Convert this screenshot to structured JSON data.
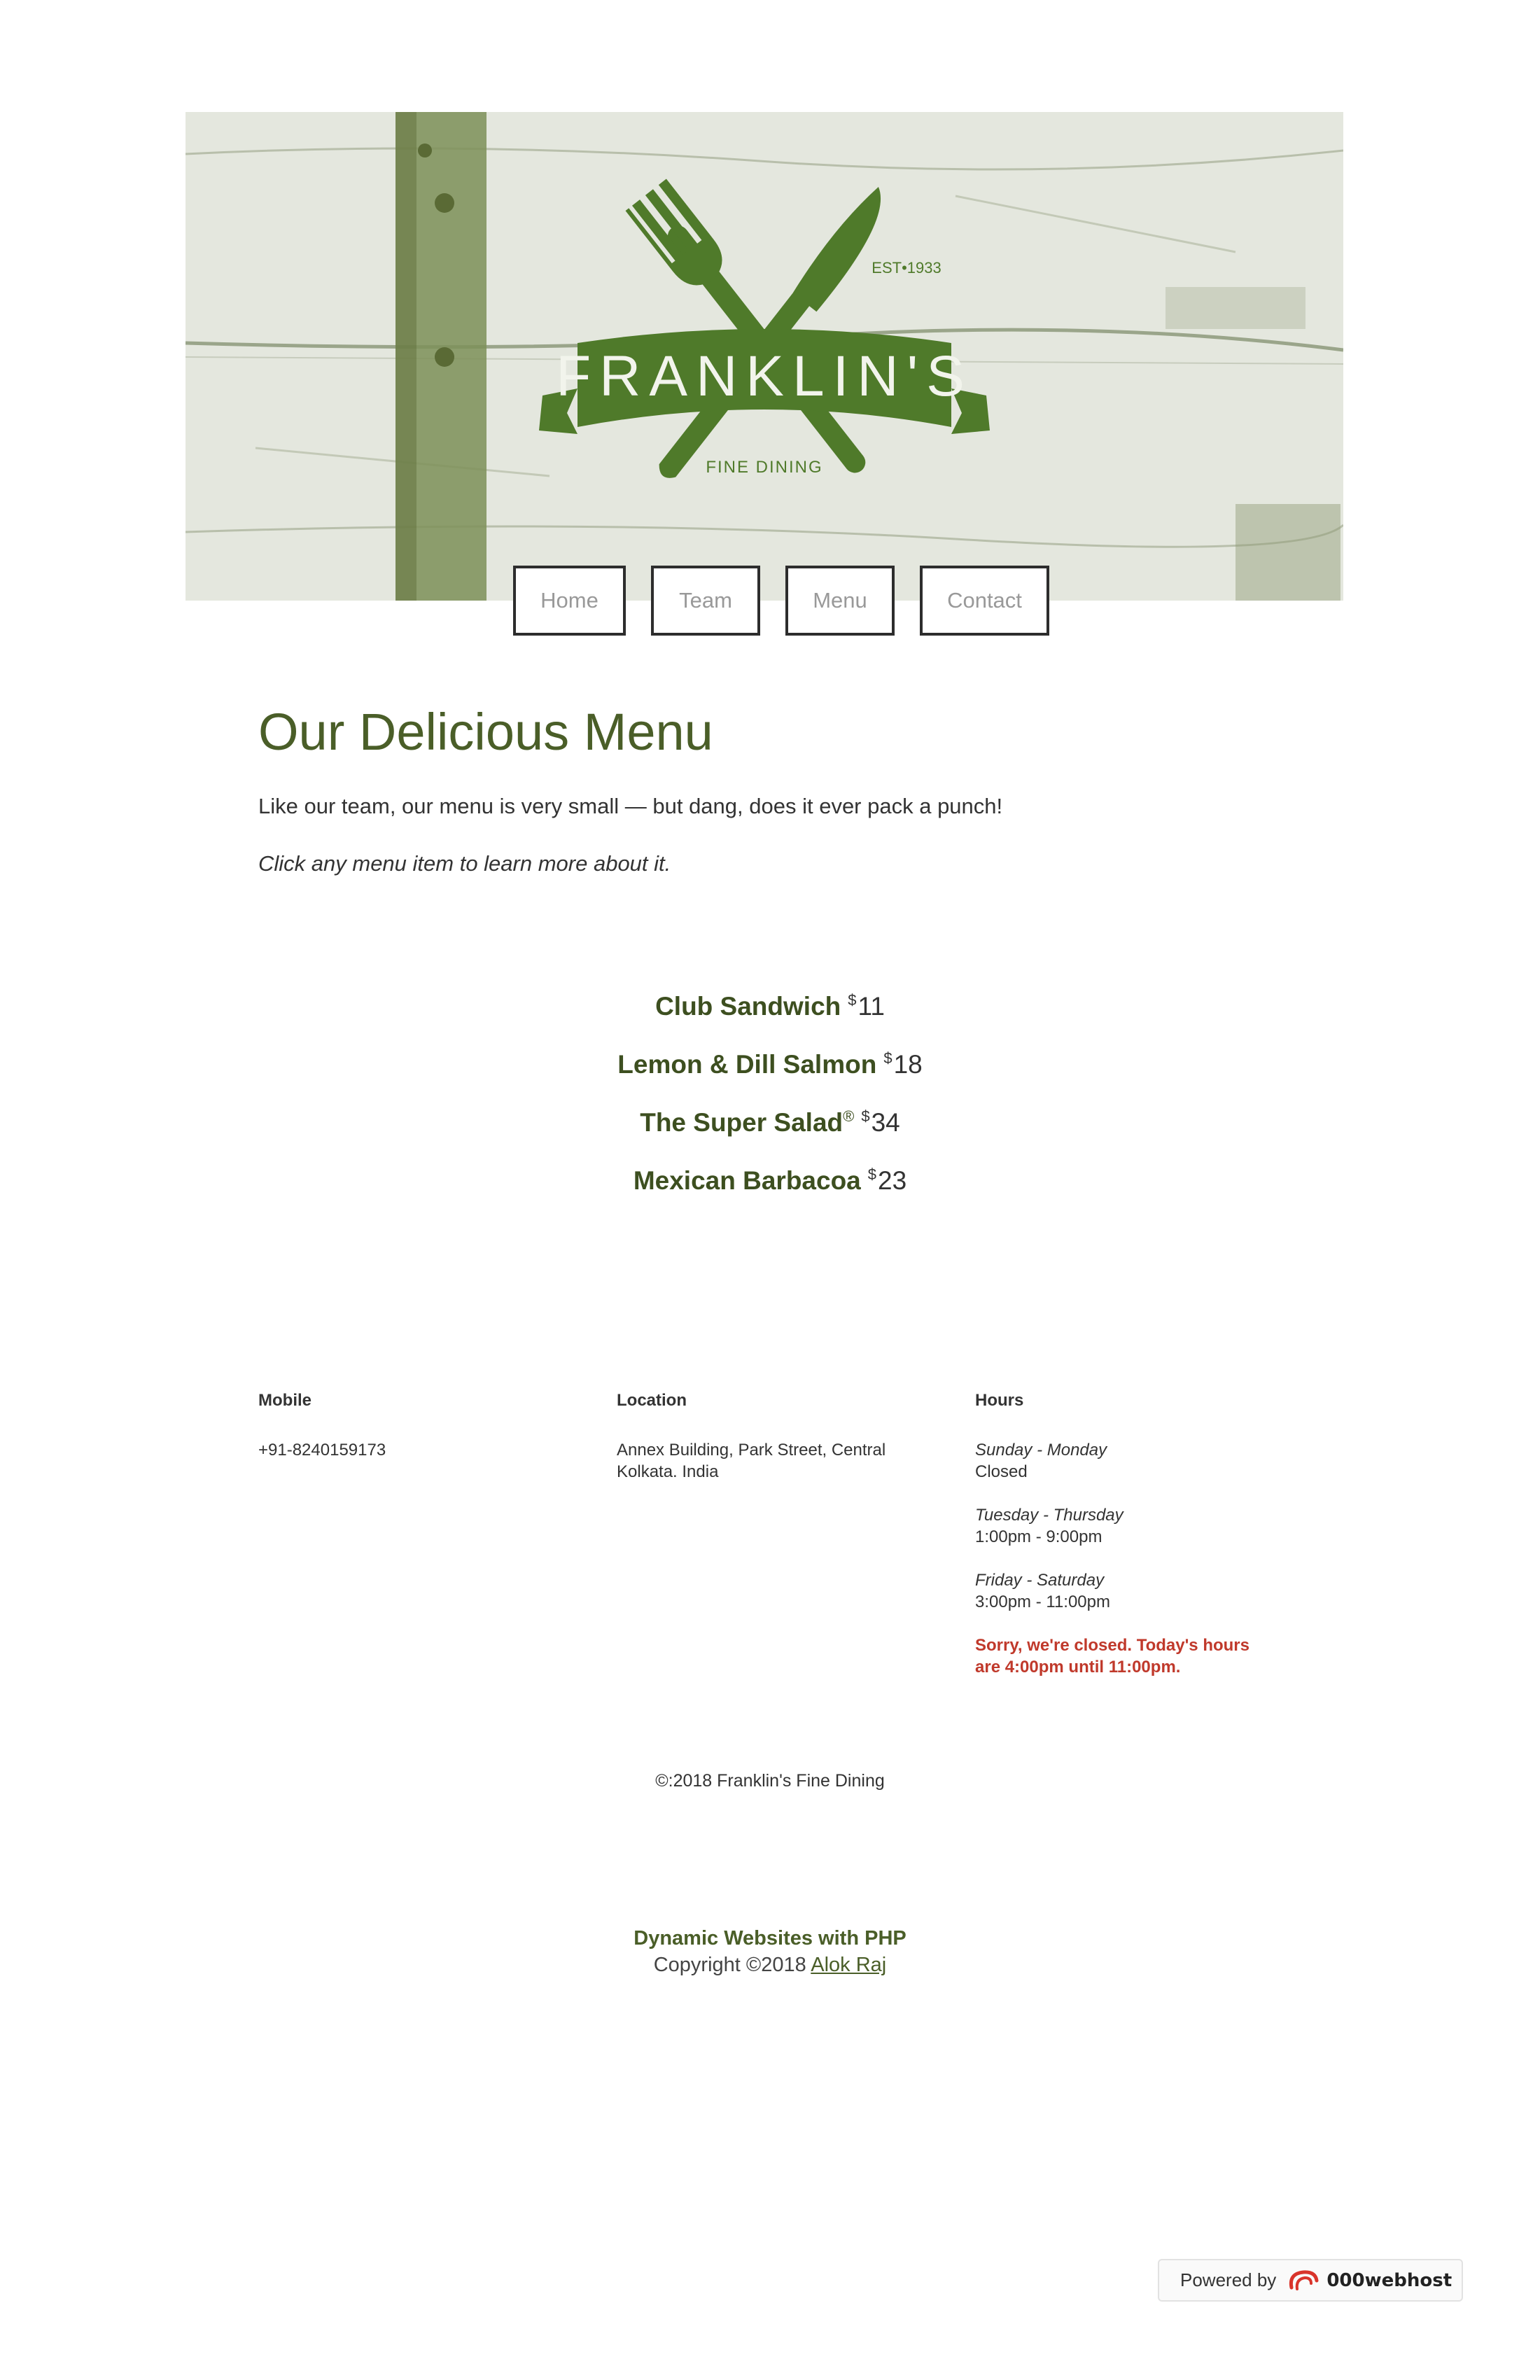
{
  "header": {
    "logo": {
      "name": "FRANKLIN'S",
      "established": "EST•1933",
      "tagline": "FINE DINING",
      "icon": "fork-and-knife-icon"
    },
    "nav": [
      "Home",
      "Team",
      "Menu",
      "Contact"
    ]
  },
  "main": {
    "title": "Our Delicious Menu",
    "intro": "Like our team, our menu is very small — but dang, does it ever pack a punch!",
    "hint": "Click any menu item to learn more about it."
  },
  "menu": [
    {
      "name": "Club Sandwich",
      "currency": "$",
      "price": "11"
    },
    {
      "name": "Lemon & Dill Salmon",
      "currency": "$",
      "price": "18"
    },
    {
      "name": "The Super Salad",
      "mark": "®",
      "currency": "$",
      "price": "34"
    },
    {
      "name": "Mexican Barbacoa",
      "currency": "$",
      "price": "23"
    }
  ],
  "footer": {
    "mobile": {
      "heading": "Mobile",
      "value": "+91-8240159173"
    },
    "location": {
      "heading": "Location",
      "value": "Annex Building, Park Street, Central Kolkata. India"
    },
    "hours": {
      "heading": "Hours",
      "blocks": [
        {
          "days": "Sunday - Monday",
          "time": "Closed"
        },
        {
          "days": "Tuesday - Thursday",
          "time": "1:00pm - 9:00pm"
        },
        {
          "days": "Friday - Saturday",
          "time": "3:00pm - 11:00pm"
        }
      ],
      "closed_note": "Sorry, we're closed. Today's hours are 4:00pm until 11:00pm."
    },
    "copyright": "©:2018 Franklin's Fine Dining"
  },
  "credit": {
    "title": "Dynamic Websites with PHP",
    "copy": "Copyright ©2018",
    "author": "Alok Raj"
  },
  "badge": {
    "powered": "Powered by",
    "brand": "000webhost",
    "icon": "000webhost-logo-icon"
  },
  "colors": {
    "accent": "#4a5e28",
    "alert": "#c0392b",
    "hero_bg": "#e7e9e1"
  }
}
